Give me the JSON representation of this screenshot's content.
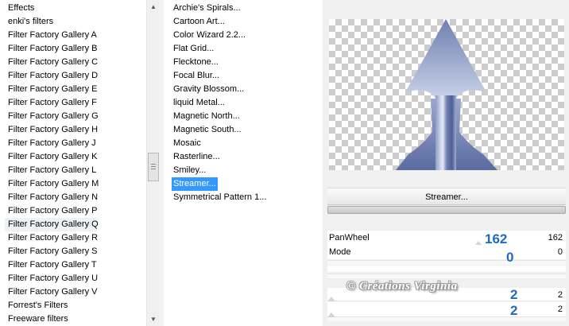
{
  "filter_list": {
    "items": [
      "Effects",
      "enki's filters",
      "Filter Factory Gallery A",
      "Filter Factory Gallery B",
      "Filter Factory Gallery C",
      "Filter Factory Gallery D",
      "Filter Factory Gallery E",
      "Filter Factory Gallery F",
      "Filter Factory Gallery G",
      "Filter Factory Gallery H",
      "Filter Factory Gallery J",
      "Filter Factory Gallery K",
      "Filter Factory Gallery L",
      "Filter Factory Gallery M",
      "Filter Factory Gallery N",
      "Filter Factory Gallery P",
      "Filter Factory Gallery Q",
      "Filter Factory Gallery R",
      "Filter Factory Gallery S",
      "Filter Factory Gallery T",
      "Filter Factory Gallery U",
      "Filter Factory Gallery V",
      "Forrest's Filters",
      "Freeware filters"
    ],
    "highlighted": "Filter Factory Gallery Q"
  },
  "effect_list": {
    "items": [
      "Archie's Spirals...",
      "Cartoon Art...",
      "Color Wizard 2.2...",
      "Flat Grid...",
      "Flecktone...",
      "Focal Blur...",
      "Gravity Blossom...",
      "liquid Metal...",
      "Magnetic North...",
      "Magnetic South...",
      "Mosaic",
      "Rasterline...",
      "Smiley...",
      "Streamer...",
      "Symmetrical Pattern 1..."
    ],
    "selected": "Streamer..."
  },
  "scrollbar_icons": {
    "up": "▲",
    "down": "▼"
  },
  "apply_button": {
    "label": "Streamer..."
  },
  "params": [
    {
      "label": "PanWheel",
      "value": "162"
    },
    {
      "label": "Mode",
      "value": "0"
    },
    {
      "label": "",
      "value": "2"
    },
    {
      "label": "",
      "value": "2"
    }
  ],
  "overlay_numbers": [
    "162",
    "0",
    "2",
    "2"
  ],
  "watermark": "© Créations Virginia",
  "colors": {
    "selection": "#3399ff",
    "overlay_numbers": "#1e6ac0",
    "preview_shape": "#7586b6"
  }
}
